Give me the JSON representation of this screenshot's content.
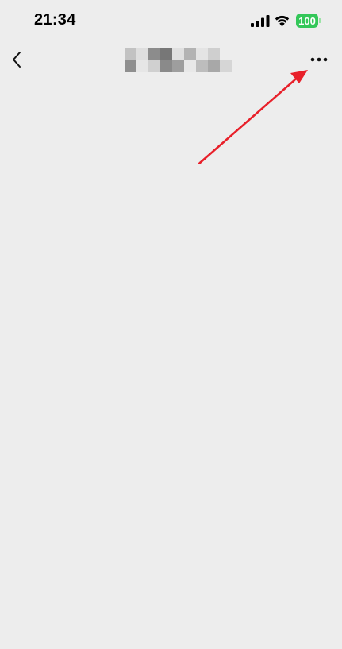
{
  "status_bar": {
    "time": "21:34",
    "battery_level": "100",
    "icons": [
      "cellular-signal-icon",
      "wifi-icon",
      "battery-icon"
    ]
  },
  "nav_bar": {
    "back_icon": "chevron-left-icon",
    "title": "",
    "title_redacted": true,
    "more_icon": "more-dots-icon"
  },
  "annotation": {
    "type": "arrow",
    "color": "#e8202a",
    "points_to": "more-button"
  },
  "colors": {
    "background": "#ededed",
    "battery": "#34c759",
    "annotation": "#e8202a"
  }
}
